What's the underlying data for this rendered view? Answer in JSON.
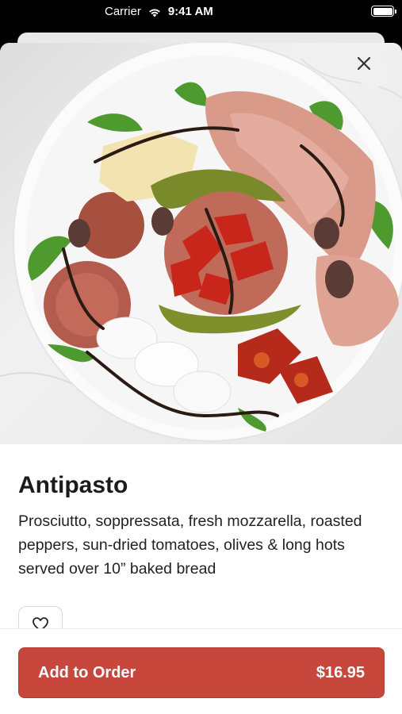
{
  "status_bar": {
    "carrier": "Carrier",
    "time": "9:41 AM"
  },
  "hero": {
    "image": "antipasto-plate-photo"
  },
  "item": {
    "title": "Antipasto",
    "description": "Prosciutto, soppressata, fresh mozzarella, roasted peppers, sun-dried tomatoes, olives & long hots served over 10” baked bread"
  },
  "actions": {
    "add_to_order_label": "Add to Order",
    "price": "$16.95"
  },
  "colors": {
    "accent": "#c8473c",
    "title_text": "#1b1b1b"
  },
  "icons": {
    "close": "close-icon",
    "favorite": "heart-icon",
    "wifi": "wifi-icon",
    "battery": "battery-icon"
  }
}
